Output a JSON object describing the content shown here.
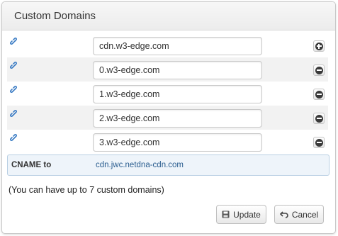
{
  "dialog": {
    "title": "Custom Domains"
  },
  "domains": [
    {
      "value": "cdn.w3-edge.com",
      "action": "add"
    },
    {
      "value": "0.w3-edge.com",
      "action": "remove"
    },
    {
      "value": "1.w3-edge.com",
      "action": "remove"
    },
    {
      "value": "2.w3-edge.com",
      "action": "remove"
    },
    {
      "value": "3.w3-edge.com",
      "action": "remove"
    }
  ],
  "cname": {
    "label": "CNAME to",
    "value": "cdn.jwc.netdna-cdn.com"
  },
  "limit_note": "(You can have up to 7 custom domains)",
  "buttons": {
    "update_label": "Update",
    "cancel_label": "Cancel"
  },
  "icons": {
    "row": "link-icon",
    "add": "plus-circle-icon",
    "remove": "minus-circle-icon",
    "update": "save-icon",
    "cancel": "undo-arrow-icon"
  },
  "colors": {
    "link_icon": "#3b7cc4",
    "cname_bg": "#eef4fa",
    "cname_text": "#2a5d8f"
  }
}
